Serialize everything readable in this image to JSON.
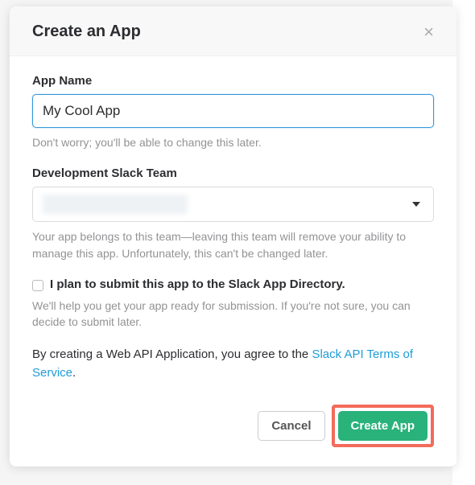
{
  "modal": {
    "title": "Create an App",
    "app_name": {
      "label": "App Name",
      "value": "My Cool App",
      "helper": "Don't worry; you'll be able to change this later."
    },
    "dev_team": {
      "label": "Development Slack Team",
      "helper": "Your app belongs to this team—leaving this team will remove your ability to manage this app. Unfortunately, this can't be changed later."
    },
    "submit_directory": {
      "label": "I plan to submit this app to the Slack App Directory.",
      "helper": "We'll help you get your app ready for submission. If you're not sure, you can decide to submit later."
    },
    "terms": {
      "prefix": "By creating a Web API Application, you agree to the ",
      "link_text": "Slack API Terms of Service",
      "suffix": "."
    },
    "buttons": {
      "cancel": "Cancel",
      "create": "Create App"
    }
  }
}
